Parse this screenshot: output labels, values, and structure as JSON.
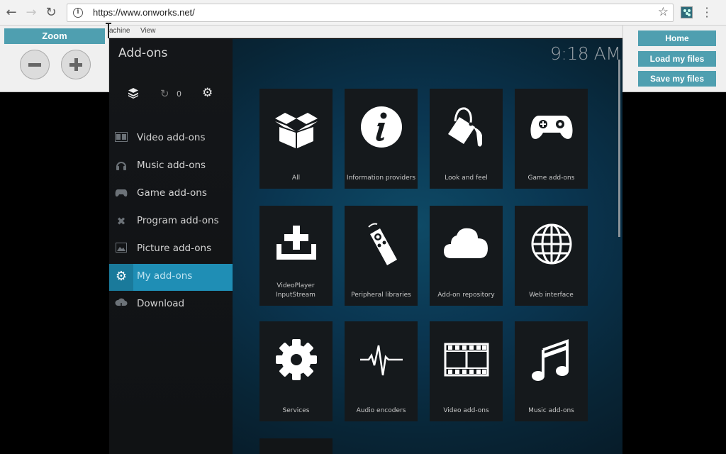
{
  "browser": {
    "url": "https://www.onworks.net/",
    "nav": {
      "back": "←",
      "forward": "→",
      "reload": "↻"
    }
  },
  "zoom_panel": {
    "title": "Zoom",
    "zoom_out": "zoom-out",
    "zoom_in": "zoom-in"
  },
  "vm_menu": {
    "items": [
      "achine",
      "View"
    ]
  },
  "right_panel": {
    "home": "Home",
    "load": "Load my files",
    "save": "Save my files"
  },
  "kodi": {
    "title": "Add-ons",
    "clock": "9:18 AM",
    "update_count": "0",
    "sidebar": [
      {
        "label": "Video add-ons",
        "icon": "film-icon",
        "active": false
      },
      {
        "label": "Music add-ons",
        "icon": "headphones-icon",
        "active": false
      },
      {
        "label": "Game add-ons",
        "icon": "gamepad-icon",
        "active": false
      },
      {
        "label": "Program add-ons",
        "icon": "program-icon",
        "active": false
      },
      {
        "label": "Picture add-ons",
        "icon": "picture-icon",
        "active": false
      },
      {
        "label": "My add-ons",
        "icon": "my-addons-icon",
        "active": true
      },
      {
        "label": "Download",
        "icon": "download-icon",
        "active": false
      }
    ],
    "tiles": [
      {
        "label": "All",
        "icon": "open-box-icon"
      },
      {
        "label": "Information providers",
        "icon": "info-icon"
      },
      {
        "label": "Look and feel",
        "icon": "paint-bucket-icon"
      },
      {
        "label": "Game add-ons",
        "icon": "gamepad-icon"
      },
      {
        "label": "VideoPlayer InputStream",
        "icon": "inputstream-icon"
      },
      {
        "label": "Peripheral libraries",
        "icon": "remote-icon"
      },
      {
        "label": "Add-on repository",
        "icon": "cloud-icon"
      },
      {
        "label": "Web interface",
        "icon": "globe-icon"
      },
      {
        "label": "Services",
        "icon": "gear-icon"
      },
      {
        "label": "Audio encoders",
        "icon": "waveform-icon"
      },
      {
        "label": "Video add-ons",
        "icon": "film-icon"
      },
      {
        "label": "Music add-ons",
        "icon": "music-note-icon"
      }
    ]
  }
}
